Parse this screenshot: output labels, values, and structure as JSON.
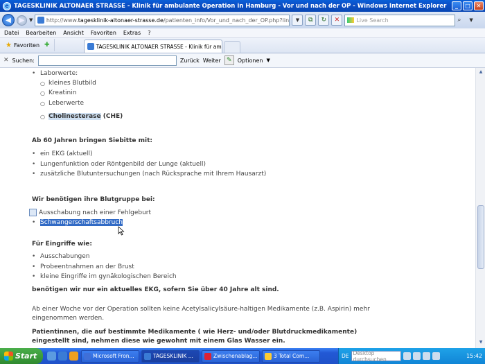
{
  "window": {
    "title": "TAGESKLINIK ALTONAER STRASSE - Klinik für ambulante Operation in Hamburg - Vor und nach der OP - Windows Internet Explorer",
    "minimize": "_",
    "maximize": "□",
    "close": "✕"
  },
  "addressbar": {
    "url_prefix": "http://www.",
    "url_domain": "tagesklinik-altonaer-strasse.de",
    "url_path": "/patienten_info/Vor_und_nach_der_OP.php?link=on",
    "search_placeholder": "Live Search"
  },
  "menu": [
    "Datei",
    "Bearbeiten",
    "Ansicht",
    "Favoriten",
    "Extras",
    "?"
  ],
  "favorites": {
    "label": "Favoriten"
  },
  "tab": {
    "label": "TAGESKLINIK ALTONAER STRASSE - Klinik für ambula..."
  },
  "findbar": {
    "label": "Suchen:",
    "back": "Zurück",
    "next": "Weiter",
    "options": "Optionen"
  },
  "content": {
    "labwerte": "Laborwerte:",
    "sub_items": [
      "kleines Blutbild",
      "Kreatinin",
      "Leberwerte"
    ],
    "cholin": "Cholinesterase",
    "che": " (CHE)",
    "age_heading": "Ab 60 Jahren bringen Siebitte mit:",
    "age_items": [
      "ein EKG (aktuell)",
      "Lungenfunktion oder Röntgenbild der Lunge (aktuell)",
      "zusätzliche Blutuntersuchungen (nach Rücksprache mit Ihrem Hausarzt)"
    ],
    "blood_heading": "Wir benötigen ihre Blutgruppe bei:",
    "blood_items": [
      "Ausschabung nach einer Fehlgeburt",
      "Schwangerschaftsabbruch"
    ],
    "eingriffe_heading": "Für Eingriffe wie:",
    "eingriffe_items": [
      "Ausschabungen",
      "Probeentnahmen an der Brust",
      "kleine Eingriffe im gynäkologischen Bereich"
    ],
    "ekg_note": "benötigen wir nur ein aktuelles  EKG, sofern Sie über 40 Jahre alt sind.",
    "aspirin_line1": "Ab  einer  Woche  vor  der  Operation  sollten  keine  Acetylsalicylsäure-haltigen  Medikamente  (z.B.  Aspirin)  mehr",
    "aspirin_line2": "eingenommen werden.",
    "patient_line1": "Patientinnen,  die  auf  bestimmte  Medikamente  (  wie  Herz-  und/oder  Blutdruckmedikamente)",
    "patient_line2": "eingestellt sind, nehmen diese wie gewohnt mit einem Glas Wasser ein."
  },
  "taskbar": {
    "start": "Start",
    "tasks": [
      {
        "label": "Microsoft Fron...",
        "color": "#3f6fd8"
      },
      {
        "label": "TAGESKLINIK ...",
        "color": "#3a7bd5"
      },
      {
        "label": "Zwischenablag...",
        "color": "#d23"
      },
      {
        "label": "3 Total Com...",
        "color": "#ffcc33"
      }
    ],
    "lang": "DE",
    "desk_search": "Desktop durchsuchen",
    "clock": "15:42"
  }
}
